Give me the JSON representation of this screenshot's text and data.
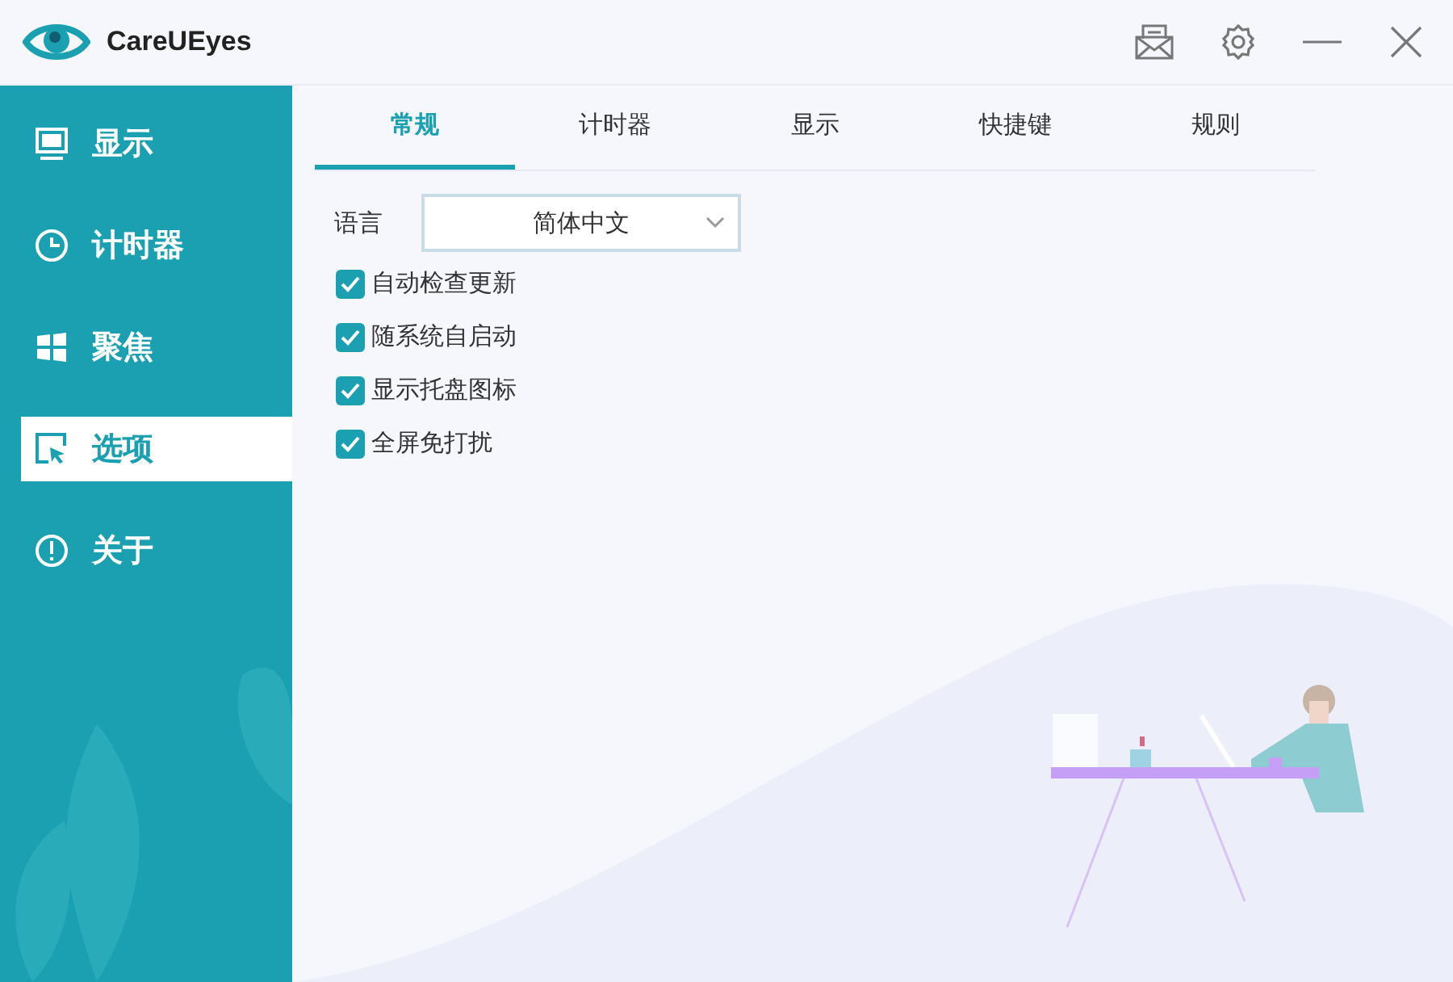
{
  "window": {
    "title": "CareUEyes"
  },
  "sidebar": {
    "items": [
      {
        "label": "显示",
        "selected": false
      },
      {
        "label": "计时器",
        "selected": false
      },
      {
        "label": "聚焦",
        "selected": false
      },
      {
        "label": "选项",
        "selected": true
      },
      {
        "label": "关于",
        "selected": false
      }
    ]
  },
  "tabs": [
    {
      "label": "常规",
      "selected": true
    },
    {
      "label": "计时器",
      "selected": false
    },
    {
      "label": "显示",
      "selected": false
    },
    {
      "label": "快捷键",
      "selected": false
    },
    {
      "label": "规则",
      "selected": false
    }
  ],
  "language": {
    "label": "语言",
    "value": "简体中文"
  },
  "options": [
    {
      "label": "自动检查更新",
      "checked": true
    },
    {
      "label": "随系统自启动",
      "checked": true
    },
    {
      "label": "显示托盘图标",
      "checked": true
    },
    {
      "label": "全屏免打扰",
      "checked": true
    }
  ]
}
